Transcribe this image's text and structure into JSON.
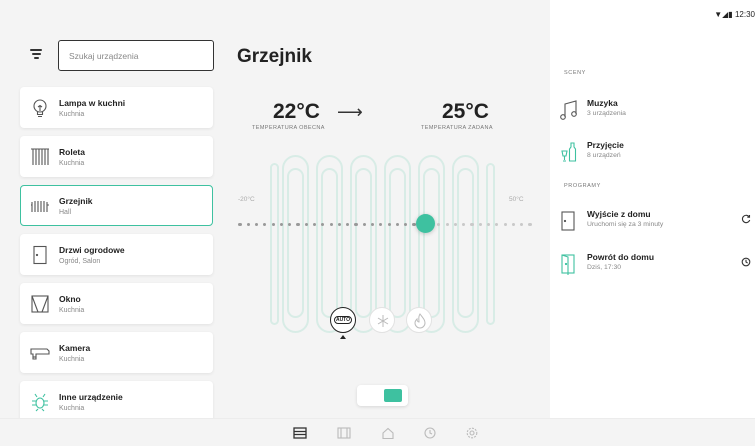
{
  "status_bar": {
    "time": "12:30"
  },
  "search": {
    "placeholder": "Szukaj urządzenia"
  },
  "devices": [
    {
      "name": "Lampa w kuchni",
      "room": "Kuchnia",
      "icon": "lamp-icon"
    },
    {
      "name": "Roleta",
      "room": "Kuchnia",
      "icon": "blind-icon"
    },
    {
      "name": "Grzejnik",
      "room": "Hall",
      "icon": "radiator-icon",
      "selected": true
    },
    {
      "name": "Drzwi ogrodowe",
      "room": "Ogród, Salon",
      "icon": "door-icon"
    },
    {
      "name": "Okno",
      "room": "Kuchnia",
      "icon": "window-icon"
    },
    {
      "name": "Kamera",
      "room": "Kuchnia",
      "icon": "camera-icon"
    },
    {
      "name": "Inne urządzenie",
      "room": "Kuchnia",
      "icon": "bug-icon"
    }
  ],
  "detail": {
    "title": "Grzejnik",
    "current_temp": "22°C",
    "current_label": "TEMPERATURA OBECNA",
    "target_temp": "25°C",
    "target_label": "TEMPERATURA ZADANA",
    "range_min": "-20°C",
    "range_max": "50°C",
    "slider_level": 0.64,
    "modes": [
      {
        "label": "AUTO",
        "icon": "auto-icon",
        "selected": true
      },
      {
        "icon": "snowflake-icon"
      },
      {
        "icon": "flame-icon"
      }
    ],
    "power_on": true
  },
  "right_panel": {
    "scenes_label": "SCENY",
    "scenes": [
      {
        "name": "Muzyka",
        "sub": "3 urządzenia",
        "icon": "music-note-icon"
      },
      {
        "name": "Przyjęcie",
        "sub": "8 urządzeń",
        "icon": "party-bottle-icon"
      }
    ],
    "programs_label": "PROGRAMY",
    "programs": [
      {
        "name": "Wyjście z domu",
        "sub": "Uruchomi się za 3 minuty",
        "icon": "exit-door-icon",
        "action": "refresh-icon"
      },
      {
        "name": "Powrót do domu",
        "sub": "Dziś, 17:30",
        "icon": "enter-door-icon",
        "action": "clock-icon"
      }
    ]
  },
  "colors": {
    "accent": "#3ec1a0",
    "background": "#f4f4f4",
    "card": "#ffffff"
  },
  "bottom_nav": [
    {
      "icon": "devices-icon",
      "active": true
    },
    {
      "icon": "scenes-icon"
    },
    {
      "icon": "home-icon"
    },
    {
      "icon": "clock-icon"
    },
    {
      "icon": "settings-icon"
    }
  ]
}
